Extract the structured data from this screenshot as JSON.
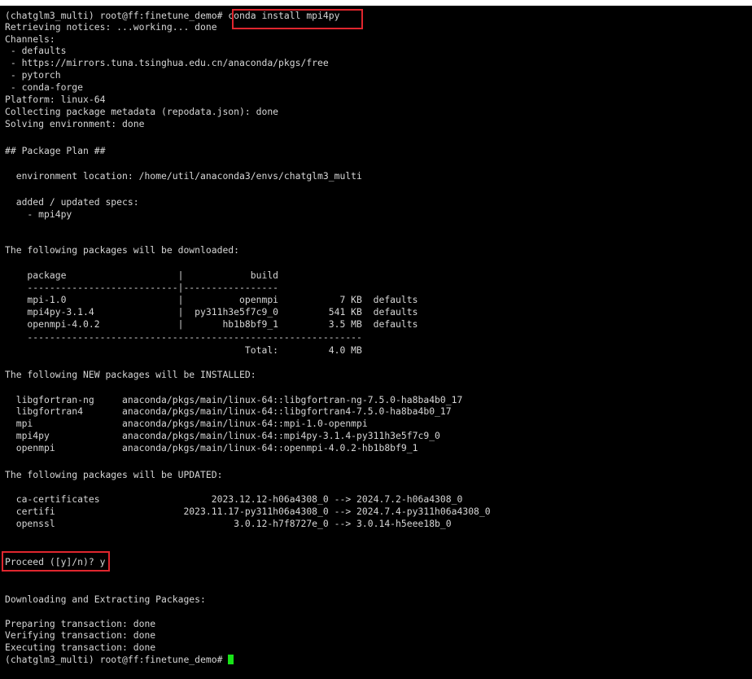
{
  "terminal": {
    "lines": [
      "(chatglm3_multi) root@ff:finetune_demo# conda install mpi4py",
      "Retrieving notices: ...working... done",
      "Channels:",
      " - defaults",
      " - https://mirrors.tuna.tsinghua.edu.cn/anaconda/pkgs/free",
      " - pytorch",
      " - conda-forge",
      "Platform: linux-64",
      "Collecting package metadata (repodata.json): done",
      "Solving environment: done",
      "",
      "## Package Plan ##",
      "",
      "  environment location: /home/util/anaconda3/envs/chatglm3_multi",
      "",
      "  added / updated specs:",
      "    - mpi4py",
      "",
      "",
      "The following packages will be downloaded:",
      "",
      "    package                    |            build",
      "    ---------------------------|-----------------",
      "    mpi-1.0                    |          openmpi           7 KB  defaults",
      "    mpi4py-3.1.4               |  py311h3e5f7c9_0         541 KB  defaults",
      "    openmpi-4.0.2              |       hb1b8bf9_1         3.5 MB  defaults",
      "    ------------------------------------------------------------",
      "                                           Total:         4.0 MB",
      "",
      "The following NEW packages will be INSTALLED:",
      "",
      "  libgfortran-ng     anaconda/pkgs/main/linux-64::libgfortran-ng-7.5.0-ha8ba4b0_17",
      "  libgfortran4       anaconda/pkgs/main/linux-64::libgfortran4-7.5.0-ha8ba4b0_17",
      "  mpi                anaconda/pkgs/main/linux-64::mpi-1.0-openmpi",
      "  mpi4py             anaconda/pkgs/main/linux-64::mpi4py-3.1.4-py311h3e5f7c9_0",
      "  openmpi            anaconda/pkgs/main/linux-64::openmpi-4.0.2-hb1b8bf9_1",
      "",
      "The following packages will be UPDATED:",
      "",
      "  ca-certificates                    2023.12.12-h06a4308_0 --> 2024.7.2-h06a4308_0",
      "  certifi                       2023.11.17-py311h06a4308_0 --> 2024.7.4-py311h06a4308_0",
      "  openssl                                3.0.12-h7f8727e_0 --> 3.0.14-h5eee18b_0",
      "",
      "",
      "Proceed ([y]/n)? y",
      "",
      "",
      "Downloading and Extracting Packages:",
      "",
      "Preparing transaction: done",
      "Verifying transaction: done",
      "Executing transaction: done",
      "(chatglm3_multi) root@ff:finetune_demo# "
    ],
    "colors": {
      "background": "#000000",
      "text": "#d6d6d6",
      "highlight_border": "#e0262e",
      "cursor": "#18e318"
    }
  }
}
